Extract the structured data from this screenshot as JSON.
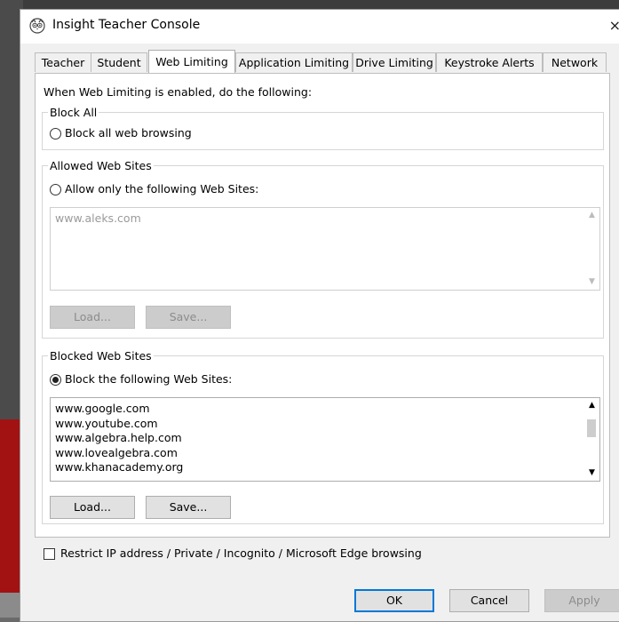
{
  "window": {
    "title": "Insight Teacher Console",
    "close_glyph": "×"
  },
  "tabs": [
    {
      "label": "Teacher"
    },
    {
      "label": "Student"
    },
    {
      "label": "Web Limiting",
      "active": true
    },
    {
      "label": "Application Limiting"
    },
    {
      "label": "Drive Limiting"
    },
    {
      "label": "Keystroke Alerts"
    },
    {
      "label": "Network"
    }
  ],
  "web_limiting": {
    "intro": "When Web Limiting is enabled, do the following:",
    "block_all": {
      "legend": "Block All",
      "option_label": "Block all web browsing",
      "selected": false
    },
    "allowed": {
      "legend": "Allowed Web Sites",
      "option_label": "Allow only the following Web Sites:",
      "selected": false,
      "sites": "www.aleks.com",
      "load_label": "Load...",
      "save_label": "Save..."
    },
    "blocked": {
      "legend": "Blocked Web Sites",
      "option_label": "Block the following Web Sites:",
      "selected": true,
      "sites": [
        "www.google.com",
        "www.youtube.com",
        "www.algebra.help.com",
        "www.lovealgebra.com",
        "www.khanacademy.org"
      ],
      "load_label": "Load...",
      "save_label": "Save..."
    },
    "restrict_label": "Restrict IP address / Private / Incognito / Microsoft Edge browsing",
    "restrict_checked": false
  },
  "footer": {
    "ok_label": "OK",
    "cancel_label": "Cancel",
    "apply_label": "Apply"
  },
  "colors": {
    "accent": "#0078d7",
    "background_red": "#a31212"
  }
}
